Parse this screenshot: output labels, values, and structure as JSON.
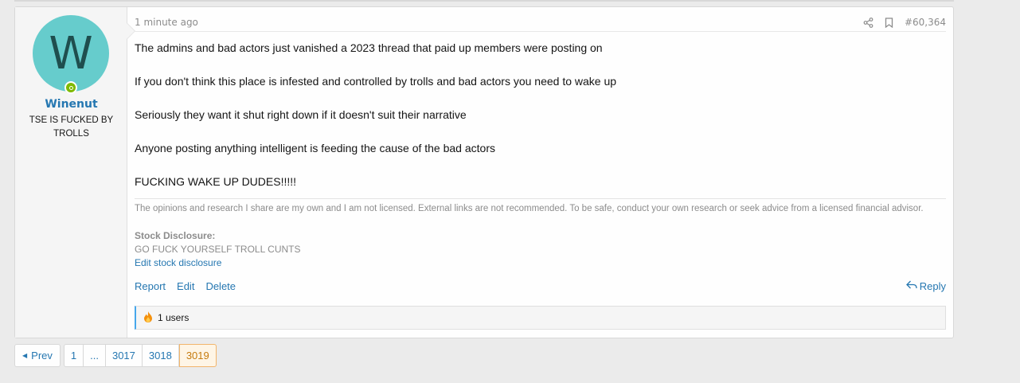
{
  "post": {
    "user": {
      "avatar_letter": "W",
      "avatar_color": "#66cccc",
      "name": "Winenut",
      "title": "TSE IS FUCKED BY TROLLS",
      "online": true
    },
    "time": "1 minute ago",
    "post_number": "#60,364",
    "body": [
      "The admins and bad actors just vanished a 2023 thread that paid up members were posting on",
      "If you don't think this place is infested and controlled by trolls and bad actors you need to wake up",
      "Seriously they want it shut right down if it doesn't suit their narrative",
      "Anyone posting anything intelligent is feeding the cause of the bad actors",
      "FUCKING WAKE UP DUDES!!!!!"
    ],
    "signature": "The opinions and research I share are my own and I am not licensed. External links are not recommended. To be safe, conduct your own research or seek advice from a licensed financial advisor.",
    "disclosure": {
      "title": "Stock Disclosure:",
      "text": "GO FUCK YOURSELF TROLL CUNTS",
      "edit_label": "Edit stock disclosure"
    },
    "actions": {
      "report": "Report",
      "edit": "Edit",
      "delete": "Delete",
      "reply": "Reply"
    },
    "reactions": {
      "icon": "fire-icon",
      "text": "1 users"
    }
  },
  "pagination": {
    "prev": "Prev",
    "pages": [
      "1",
      "...",
      "3017",
      "3018",
      "3019"
    ],
    "current": "3019"
  },
  "colors": {
    "link": "#2577b1",
    "muted": "#8c8c8c",
    "online": "#7fb900",
    "current_page_bg": "#fef5e6"
  }
}
